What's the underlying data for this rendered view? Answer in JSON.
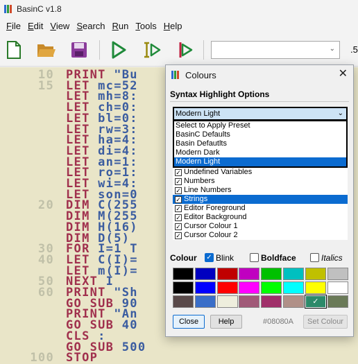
{
  "window": {
    "title": "BasinC v1.8"
  },
  "menu": [
    {
      "accel": "F",
      "rest": "ile"
    },
    {
      "accel": "E",
      "rest": "dit"
    },
    {
      "accel": "V",
      "rest": "iew"
    },
    {
      "accel": "S",
      "rest": "earch"
    },
    {
      "accel": "R",
      "rest": "un"
    },
    {
      "accel": "T",
      "rest": "ools"
    },
    {
      "accel": "H",
      "rest": "elp"
    }
  ],
  "toolbar": {
    "icons": [
      "new-file-icon",
      "open-folder-icon",
      "save-icon",
      "run-icon",
      "step-run-icon",
      "debug-icon"
    ],
    "combo_value": "",
    "extra": ".5"
  },
  "editor": {
    "lines": [
      {
        "num": "10",
        "kw": "PRINT",
        "rest": " \"Bu"
      },
      {
        "num": "15",
        "kw": "LET",
        "rest": " mc=52"
      },
      {
        "num": "",
        "kw": "LET",
        "rest": " mh=8:"
      },
      {
        "num": "",
        "kw": "LET",
        "rest": " ch=0:"
      },
      {
        "num": "",
        "kw": "LET",
        "rest": " bl=0:"
      },
      {
        "num": "",
        "kw": "LET",
        "rest": " rw=3:"
      },
      {
        "num": "",
        "kw": "LET",
        "rest": " ha=4:"
      },
      {
        "num": "",
        "kw": "LET",
        "rest": " di=4:"
      },
      {
        "num": "",
        "kw": "LET",
        "rest": " an=1:"
      },
      {
        "num": "",
        "kw": "LET",
        "rest": " ro=1:"
      },
      {
        "num": "",
        "kw": "LET",
        "rest": " wi=4:"
      },
      {
        "num": "",
        "kw": "LET",
        "rest": " son=0"
      },
      {
        "num": "20",
        "kw": "DIM",
        "rest": " C(255"
      },
      {
        "num": "",
        "kw": "DIM",
        "rest": " M(255"
      },
      {
        "num": "",
        "kw": "DIM",
        "rest": " H(16)"
      },
      {
        "num": "",
        "kw": "DIM",
        "rest": " D(5)"
      },
      {
        "num": "30",
        "kw": "FOR",
        "rest": " I=1 T"
      },
      {
        "num": "40",
        "kw": "LET",
        "rest": " C(I)="
      },
      {
        "num": "",
        "kw": "LET",
        "rest": " m(I)="
      },
      {
        "num": "50",
        "kw": "NEXT",
        "rest": " I"
      },
      {
        "num": "60",
        "kw": "PRINT",
        "rest": " \"Sh"
      },
      {
        "num": "",
        "kw": "GO SUB",
        "rest": " 90"
      },
      {
        "num": "",
        "kw": "PRINT",
        "rest": " \"An"
      },
      {
        "num": "",
        "kw": "GO SUB",
        "rest": " 40"
      },
      {
        "num": "",
        "kw": "CLS",
        "rest": " :"
      },
      {
        "num": "",
        "kw": "GO SUB",
        "rest": " 500"
      },
      {
        "num": "100",
        "kw": "STOP",
        "rest": ""
      }
    ]
  },
  "dialog": {
    "title": "Colours",
    "section": "Syntax Highlight Options",
    "preset_value": "Modern Light",
    "preset_options": [
      "Select to Apply Preset",
      "BasinC Defaults",
      "Basin Defautlts",
      "Modern Dark",
      "Modern Light"
    ],
    "preset_selected_index": 4,
    "items": [
      {
        "label": "Undefined Variables",
        "checked": true
      },
      {
        "label": "Numbers",
        "checked": true
      },
      {
        "label": "Line Numbers",
        "checked": true
      },
      {
        "label": "Strings",
        "checked": true,
        "selected": true
      },
      {
        "label": "Editor Foreground",
        "checked": true
      },
      {
        "label": "Editor Background",
        "checked": true
      },
      {
        "label": "Cursor Colour 1",
        "checked": true
      },
      {
        "label": "Cursor Colour 2",
        "checked": true
      }
    ],
    "colour_label": "Colour",
    "blink_label": "Blink",
    "blink_checked": true,
    "boldface_label": "Boldface",
    "boldface_checked": false,
    "italics_label": "Italics",
    "italics_checked": false,
    "palette": [
      [
        "#000000",
        "#0000c0",
        "#c00000",
        "#c000c0",
        "#00c000",
        "#00c0c0",
        "#c0c000",
        "#c0c0c0"
      ],
      [
        "#000000",
        "#0000ff",
        "#ff0000",
        "#ff00ff",
        "#00ff00",
        "#00ffff",
        "#ffff00",
        "#ffffff"
      ],
      [
        "#5a4a4a",
        "#3a6ec8",
        "#eeeedd",
        "#a05a78",
        "#a0306a",
        "#b09088",
        "#2d8a6a",
        "#6a7a58"
      ]
    ],
    "active_swatch": {
      "row": 2,
      "col": 6
    },
    "close_label": "Close",
    "help_label": "Help",
    "hex_value": "#08080A",
    "set_colour_label": "Set Colour"
  }
}
